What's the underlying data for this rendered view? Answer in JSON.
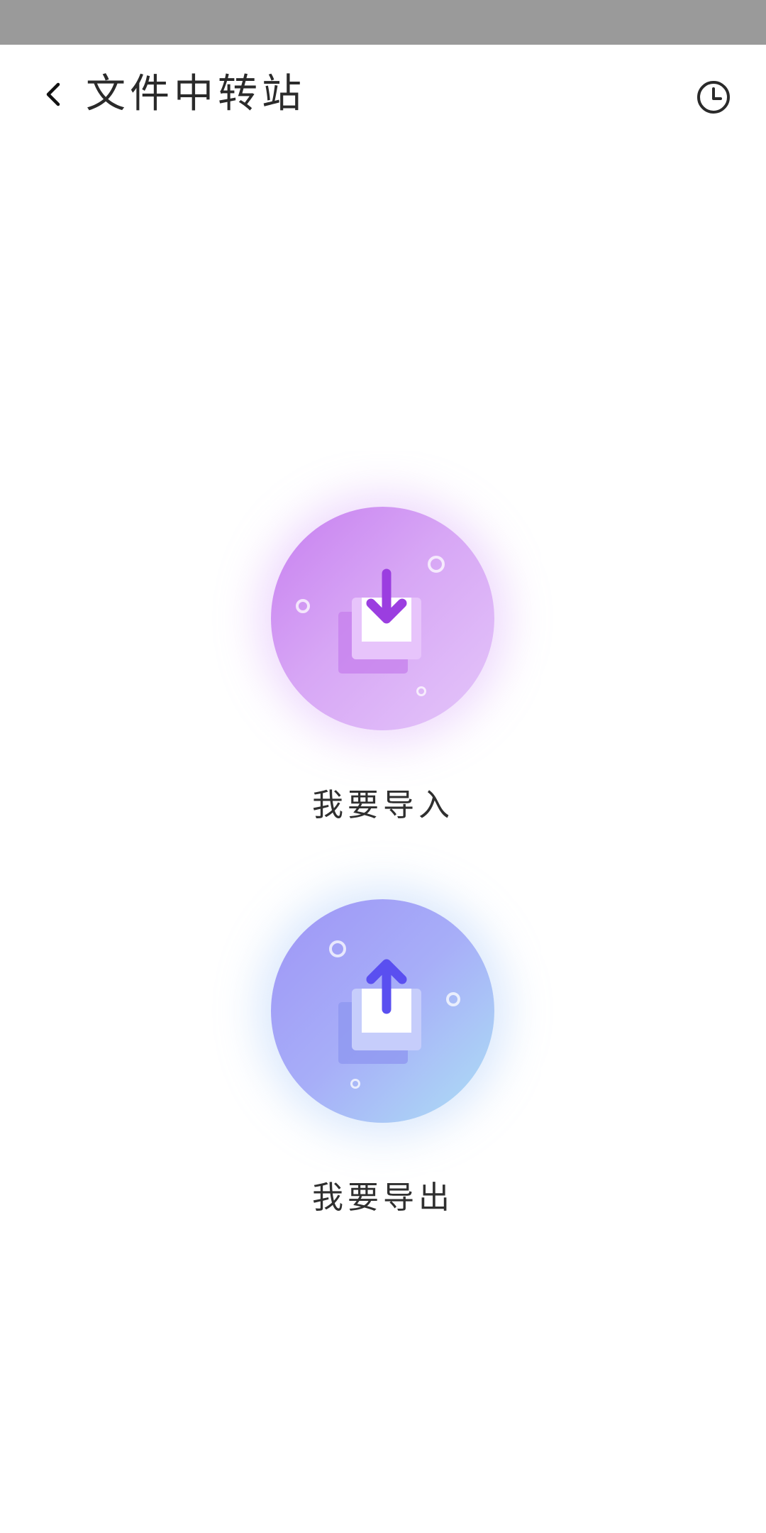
{
  "status_bar": {},
  "header": {
    "title": "文件中转站",
    "back_icon": "chevron-left-icon",
    "history_icon": "clock-icon"
  },
  "actions": [
    {
      "label": "我要导入",
      "icon": "download-icon",
      "colors": {
        "start": "#c77ff0",
        "end": "#e4c6fa",
        "arrow": "#9b3ee0"
      }
    },
    {
      "label": "我要导出",
      "icon": "upload-icon",
      "colors": {
        "start": "#9e95f6",
        "end": "#ade0f5",
        "arrow": "#5a4ff0"
      }
    }
  ]
}
